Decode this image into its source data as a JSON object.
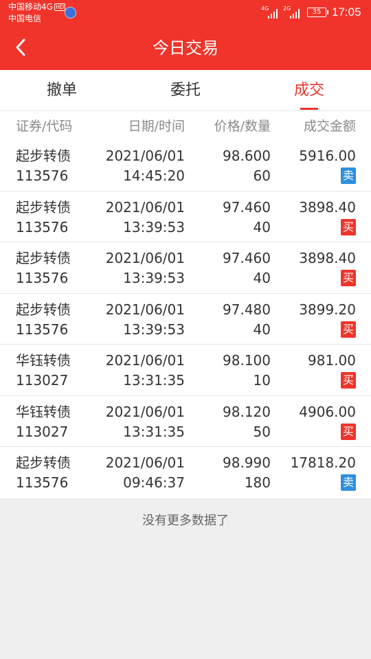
{
  "status_bar": {
    "carrier_top": "中国移动4G",
    "hd": "HD",
    "carrier_bottom": "中国电信",
    "signal1_label": "4G",
    "signal2_label": "2G",
    "battery": "35",
    "time": "17:05"
  },
  "header": {
    "title": "今日交易"
  },
  "tabs": [
    {
      "label": "撤单",
      "active": false
    },
    {
      "label": "委托",
      "active": false
    },
    {
      "label": "成交",
      "active": true
    }
  ],
  "table": {
    "headers": [
      "证券/代码",
      "日期/时间",
      "价格/数量",
      "成交金额"
    ],
    "rows": [
      {
        "name": "起步转债",
        "code": "113576",
        "date": "2021/06/01",
        "time": "14:45:20",
        "price": "98.600",
        "qty": "60",
        "amount": "5916.00",
        "side": "卖",
        "side_type": "sell"
      },
      {
        "name": "起步转债",
        "code": "113576",
        "date": "2021/06/01",
        "time": "13:39:53",
        "price": "97.460",
        "qty": "40",
        "amount": "3898.40",
        "side": "买",
        "side_type": "buy"
      },
      {
        "name": "起步转债",
        "code": "113576",
        "date": "2021/06/01",
        "time": "13:39:53",
        "price": "97.460",
        "qty": "40",
        "amount": "3898.40",
        "side": "买",
        "side_type": "buy"
      },
      {
        "name": "起步转债",
        "code": "113576",
        "date": "2021/06/01",
        "time": "13:39:53",
        "price": "97.480",
        "qty": "40",
        "amount": "3899.20",
        "side": "买",
        "side_type": "buy"
      },
      {
        "name": "华钰转债",
        "code": "113027",
        "date": "2021/06/01",
        "time": "13:31:35",
        "price": "98.100",
        "qty": "10",
        "amount": "981.00",
        "side": "买",
        "side_type": "buy"
      },
      {
        "name": "华钰转债",
        "code": "113027",
        "date": "2021/06/01",
        "time": "13:31:35",
        "price": "98.120",
        "qty": "50",
        "amount": "4906.00",
        "side": "买",
        "side_type": "buy"
      },
      {
        "name": "起步转债",
        "code": "113576",
        "date": "2021/06/01",
        "time": "09:46:37",
        "price": "98.990",
        "qty": "180",
        "amount": "17818.20",
        "side": "卖",
        "side_type": "sell"
      }
    ]
  },
  "footer_text": "没有更多数据了",
  "colors": {
    "brand_red": "#f0342b",
    "active_tab": "#e8342a",
    "sell_blue": "#2e8fe0",
    "buy_red": "#f0342b"
  }
}
